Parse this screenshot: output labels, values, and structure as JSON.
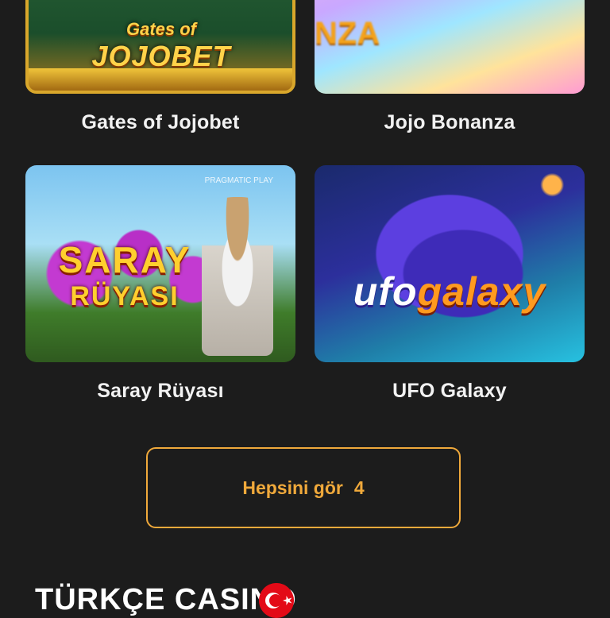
{
  "games": [
    {
      "title": "Gates of Jojobet",
      "thumb_text_top": "Gates of",
      "thumb_text_main": "JOJOBET"
    },
    {
      "title": "Jojo Bonanza",
      "thumb_text_main": "NZA"
    },
    {
      "title": "Saray Rüyası",
      "thumb_text_top": "SARAY",
      "thumb_text_main": "RÜYASI",
      "provider": "PRAGMATIC PLAY"
    },
    {
      "title": "UFO Galaxy",
      "thumb_text_top": "ufo",
      "thumb_text_main": "galaxy"
    }
  ],
  "see_all": {
    "label": "Hepsini gör",
    "count": "4"
  },
  "brand": {
    "name": "TÜRKÇE CASINO"
  },
  "colors": {
    "background": "#1c1c1c",
    "accent": "#f0a93b",
    "text": "#f2f2f2",
    "flag": "#e30a17"
  },
  "icons": {
    "flag": "turkey-flag-icon"
  }
}
